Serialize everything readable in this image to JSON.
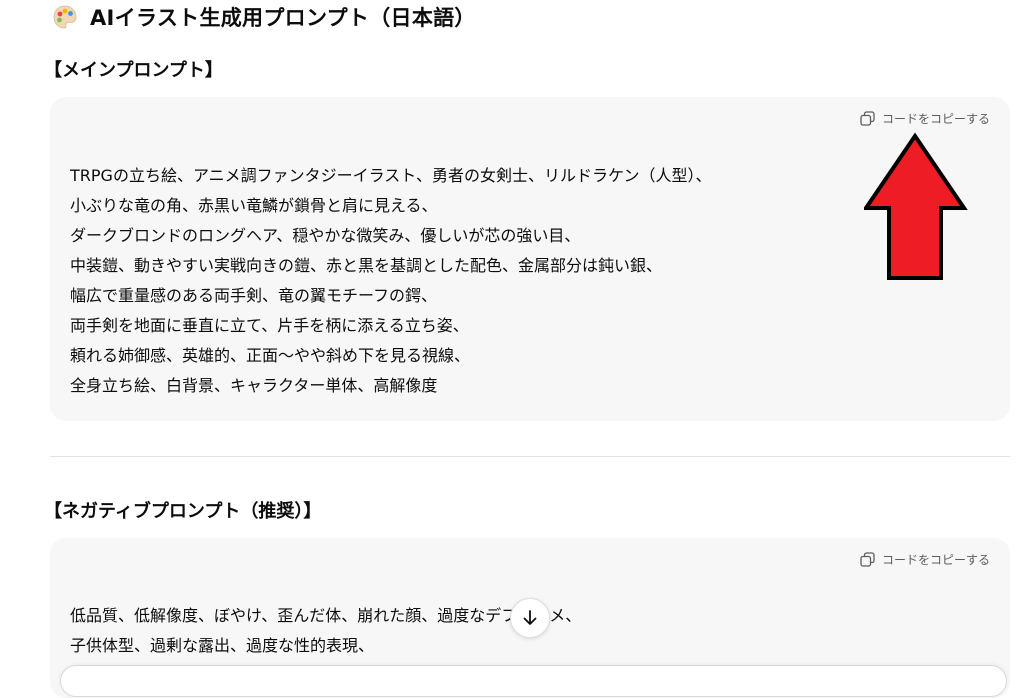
{
  "page": {
    "title": "AIイラスト生成用プロンプト（日本語）",
    "title_icon": "palette-icon"
  },
  "main_prompt": {
    "heading": "【メインプロンプト】",
    "copy_label": "コードをコピーする",
    "lines": [
      "TRPGの立ち絵、アニメ調ファンタジーイラスト、勇者の女剣士、リルドラケン（人型）、",
      "小ぶりな竜の角、赤黒い竜鱗が鎖骨と肩に見える、",
      "ダークブロンドのロングヘア、穏やかな微笑み、優しいが芯の強い目、",
      "中装鎧、動きやすい実戦向きの鎧、赤と黒を基調とした配色、金属部分は鈍い銀、",
      "幅広で重量感のある両手剣、竜の翼モチーフの鍔、",
      "両手剣を地面に垂直に立て、片手を柄に添える立ち姿、",
      "頼れる姉御感、英雄的、正面〜やや斜め下を見る視線、",
      "全身立ち絵、白背景、キャラクター単体、高解像度"
    ]
  },
  "negative_prompt": {
    "heading": "【ネガティブプロンプト（推奨）】",
    "copy_label": "コードをコピーする",
    "lines": [
      "低品質、低解像度、ぼやけ、歪んだ体、崩れた顔、過度なデフォルメ、",
      "子供体型、過剰な露出、過度な性的表現、"
    ]
  },
  "annotation": {
    "arrow_color": "#ee1c25",
    "arrow_icon": "red-arrow-up-icon"
  },
  "colors": {
    "code_block_bg": "#f7f7f7",
    "text": "#0d0d0d",
    "muted": "#5d5d5d"
  }
}
